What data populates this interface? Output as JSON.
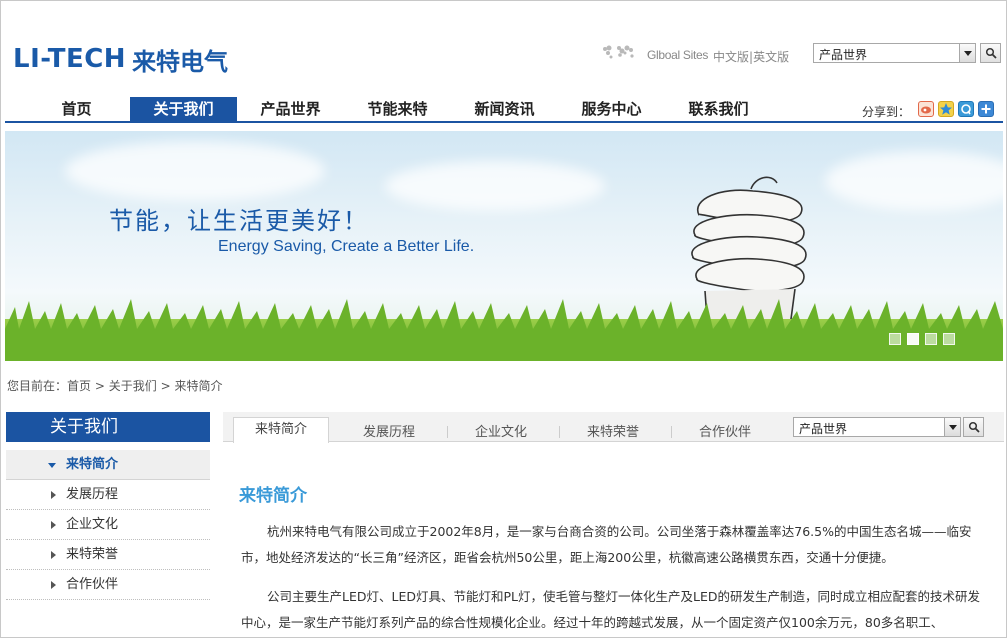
{
  "header": {
    "logo_en": "LI-TECH",
    "logo_cn": "来特电气",
    "global_sites": "Glboal Sites",
    "lang_cn": "中文版",
    "lang_sep": "|",
    "lang_en": "英文版",
    "top_select_value": "产品世界",
    "search_icon": "magnifier-icon"
  },
  "nav": {
    "items": [
      "首页",
      "关于我们",
      "产品世界",
      "节能来特",
      "新闻资讯",
      "服务中心",
      "联系我们"
    ],
    "active_index": 1,
    "share_label": "分享到："
  },
  "banner": {
    "title": "节能，让生活更美好！",
    "subtitle": "Energy Saving, Create a Better Life.",
    "slides": 4,
    "active_slide": 1
  },
  "breadcrumb": {
    "prefix": "您目前在：",
    "items": [
      "首页",
      "关于我们",
      "来特简介"
    ],
    "sep": ">"
  },
  "sidebar": {
    "title": "关于我们",
    "items": [
      "来特简介",
      "发展历程",
      "企业文化",
      "来特荣誉",
      "合作伙伴"
    ],
    "active_index": 0
  },
  "tabs": {
    "items": [
      "来特简介",
      "发展历程",
      "企业文化",
      "来特荣誉",
      "合作伙伴"
    ],
    "select_value": "产品世界"
  },
  "content": {
    "title": "来特简介",
    "p1": "杭州来特电气有限公司成立于2002年8月，是一家与台商合资的公司。公司坐落于森林覆盖率达76.5%的中国生态名城——临安市，地处经济发达的“长三角”经济区，距省会杭州50公里，距上海200公里，杭徽高速公路横贯东西，交通十分便捷。",
    "p2": "公司主要生产LED灯、LED灯具、节能灯和PL灯，使毛管与整灯一体化生产及LED的研发生产制造，同时成立相应配套的技术研发中心，是一家生产节能灯系列产品的综合性规模化企业。经过十年的跨越式发展，从一个固定资产仅100余万元，80多名职工、"
  },
  "colors": {
    "brand_blue": "#1b54a2",
    "title_blue": "#3a9ad8"
  }
}
